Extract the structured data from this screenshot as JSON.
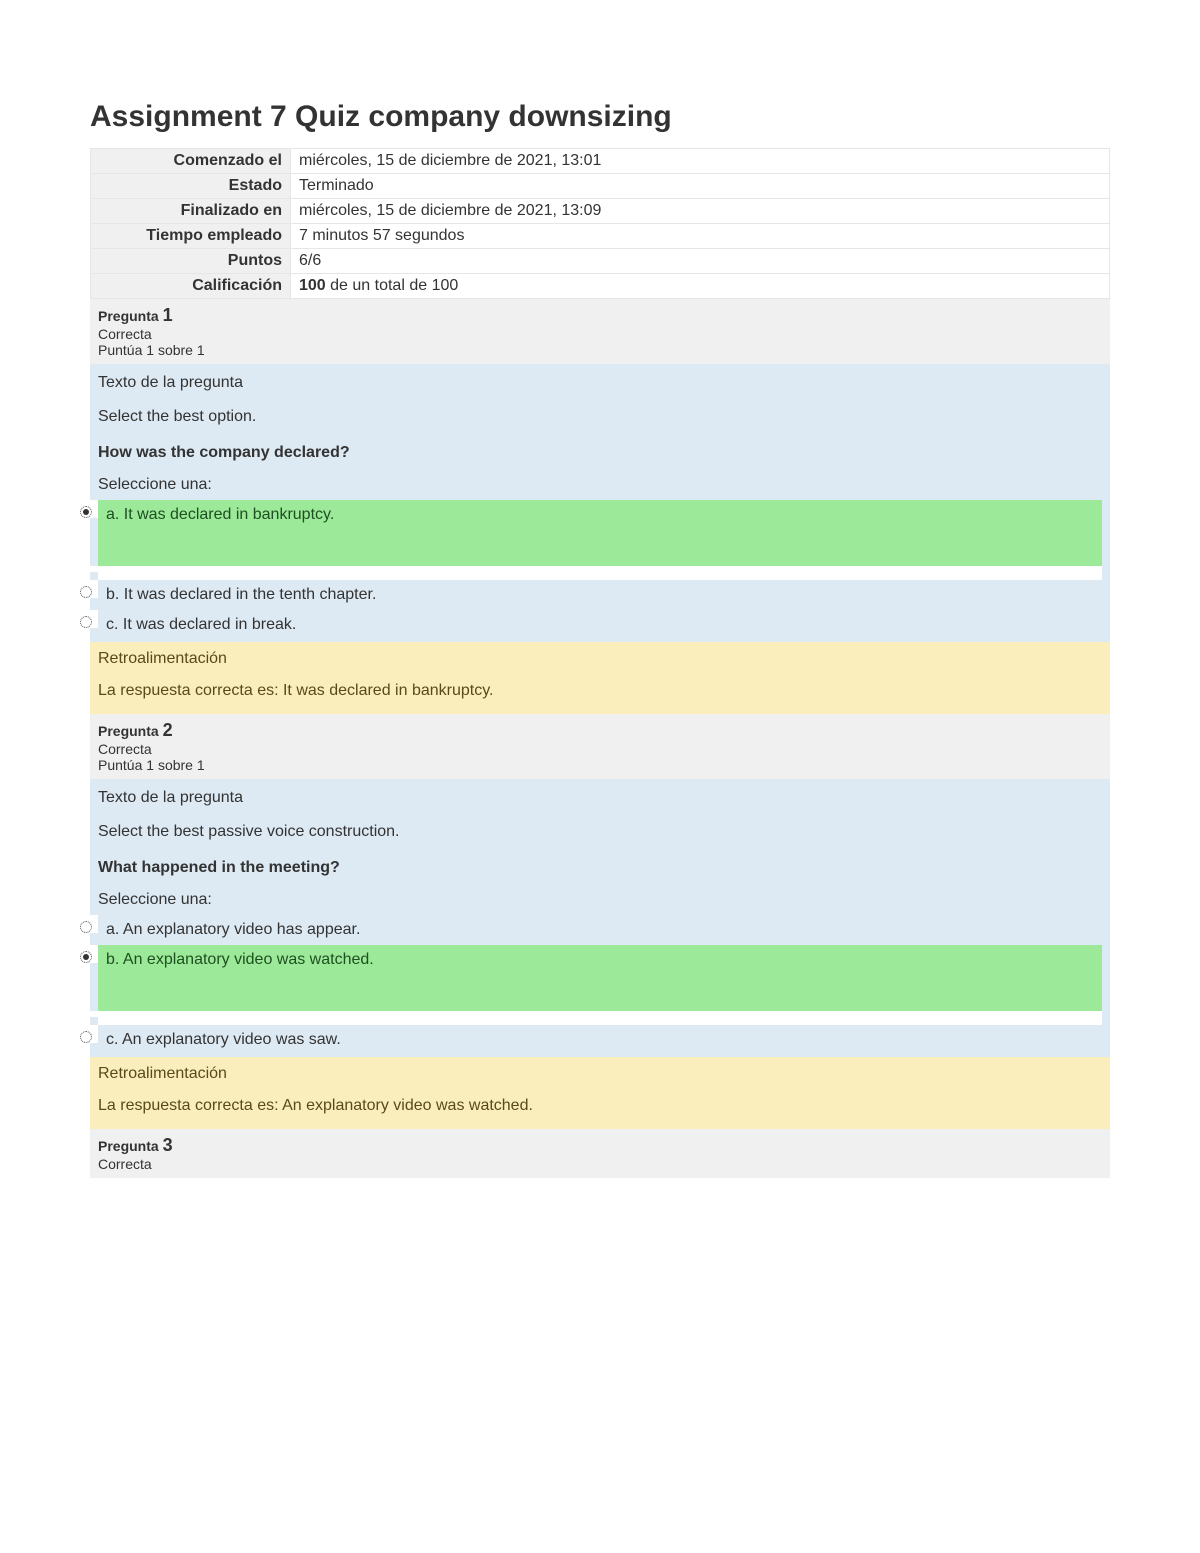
{
  "page_title": "Assignment 7 Quiz company downsizing",
  "summary": {
    "rows": [
      {
        "label": "Comenzado el",
        "value": "miércoles, 15 de diciembre de 2021, 13:01"
      },
      {
        "label": "Estado",
        "value": "Terminado"
      },
      {
        "label": "Finalizado en",
        "value": "miércoles, 15 de diciembre de 2021, 13:09"
      },
      {
        "label": "Tiempo empleado",
        "value": "7 minutos 57 segundos"
      },
      {
        "label": "Puntos",
        "value": "6/6"
      },
      {
        "label": "Calificación",
        "value_bold": "100",
        "value_rest": " de un total de 100"
      }
    ]
  },
  "labels": {
    "pregunta": "Pregunta",
    "texto_pregunta": "Texto de la pregunta",
    "seleccione": "Seleccione una:",
    "retro": "Retroalimentación",
    "respuesta_correcta": "La respuesta correcta es: "
  },
  "questions": [
    {
      "number": "1",
      "status": "Correcta",
      "score": "Puntúa 1 sobre 1",
      "instruction": "Select the best option.",
      "prompt": "How was the company declared?",
      "options": [
        {
          "text": "a. It was declared in bankruptcy.",
          "correct": true,
          "selected": true
        },
        {
          "text": "b. It was declared in the tenth chapter.",
          "correct": false,
          "selected": false
        },
        {
          "text": "c. It was declared in break.",
          "correct": false,
          "selected": false
        }
      ],
      "correct_answer": "It was declared in bankruptcy.",
      "show_feedback": true
    },
    {
      "number": "2",
      "status": "Correcta",
      "score": "Puntúa 1 sobre 1",
      "instruction": "Select the best passive voice construction.",
      "prompt": "What happened in the meeting?",
      "options": [
        {
          "text": "a. An explanatory video has appear.",
          "correct": false,
          "selected": false
        },
        {
          "text": "b. An explanatory video was watched.",
          "correct": true,
          "selected": true
        },
        {
          "text": "c. An explanatory video was saw.",
          "correct": false,
          "selected": false
        }
      ],
      "correct_answer": "An explanatory video was watched.",
      "show_feedback": true
    },
    {
      "number": "3",
      "status": "Correcta",
      "score": "",
      "instruction": "",
      "prompt": "",
      "options": [],
      "correct_answer": "",
      "show_feedback": false
    }
  ]
}
